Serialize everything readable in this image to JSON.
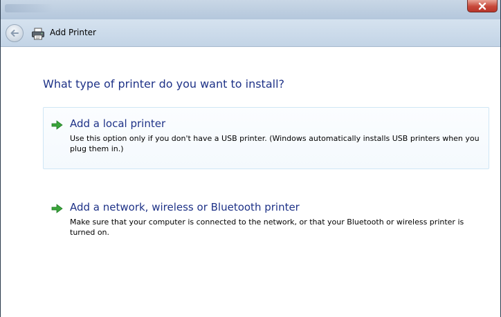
{
  "window": {
    "title": "Add Printer",
    "icons": {
      "close": "close-icon",
      "back": "back-arrow-icon",
      "app": "printer-icon"
    }
  },
  "main": {
    "heading": "What type of printer do you want to install?",
    "options": [
      {
        "title": "Add a local printer",
        "description": "Use this option only if you don't have a USB printer. (Windows automatically installs USB printers when you plug them in.)",
        "icon": "green-arrow-icon",
        "selected": true
      },
      {
        "title": "Add a network, wireless or Bluetooth printer",
        "description": "Make sure that your computer is connected to the network, or that your Bluetooth or wireless printer is turned on.",
        "icon": "green-arrow-icon",
        "selected": false
      }
    ]
  },
  "colors": {
    "heading": "#1e3287",
    "option_border": "#cfe6f5",
    "arrow": "#3aa53a",
    "close_button": "#c7483a"
  }
}
